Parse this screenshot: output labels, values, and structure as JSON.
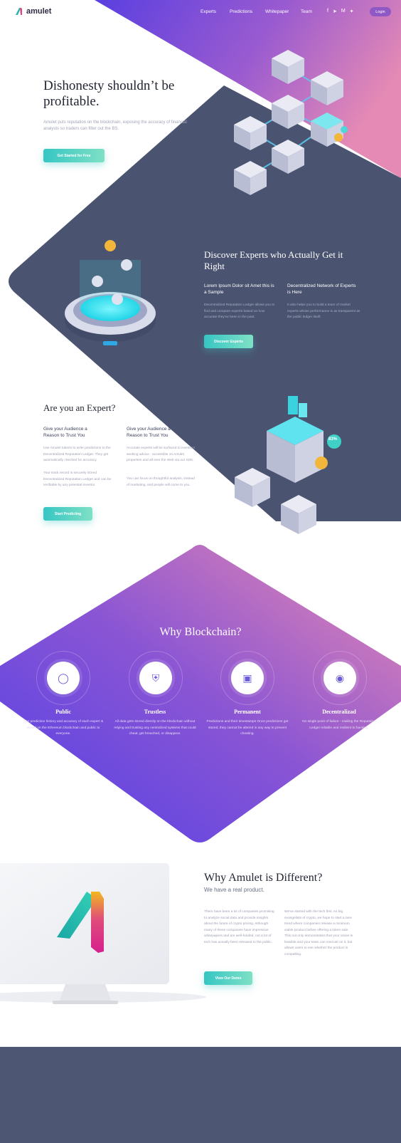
{
  "brand": {
    "name": "amulet"
  },
  "nav": {
    "items": [
      "Experts",
      "Predictions",
      "Whitepaper",
      "Team"
    ],
    "socials": [
      "facebook-icon",
      "telegram-icon",
      "medium-icon",
      "twitter-icon"
    ],
    "login": "Login"
  },
  "hero": {
    "title": "Dishonesty shouldn’t be profitable.",
    "lead": "Amulet puts reputation on the blockchain, exposing the accuracy of financial analysts so traders can filter out the BS.",
    "cta": "Get Started for Free"
  },
  "discover": {
    "title": "Discover Experts who Actually Get it Right",
    "col1_title": "Lorem Ipsum Dolor sit Amet this is a Sample",
    "col1_text": "Decentralized Reputation Ledger allows you to find and compare experts based on how accurate they've been in the past.",
    "col2_title": "Decentralized Network of Experts is Here",
    "col2_text": "It also helps you to build a team of market experts whose performance is as transparent as the public ledger itself.",
    "cta": "Discover Experts"
  },
  "expert": {
    "title": "Are you an Expert?",
    "col1_title": "Give your Audience a Reason to Trust You",
    "col1_text1": "Use Amulet tokens to write predictions to the Decentralized Reputation Ledger. They get automatically checked for accuracy.",
    "col1_text2": "Your track record is securely stored Decentralized Reputation Ledger and can be verifiable by any potential investor.",
    "col2_title": "Give your Audience a Reason to Trust You",
    "col2_text1": "Accurate experts will be surfaced to investors seeking advice - accessible on Amulet properties and all over the Web via our SDK.",
    "col2_text2": "You can focus on thoughtful analysis, instead of marketing, and people will come to you.",
    "cta": "Start Predicting",
    "badge": "83%"
  },
  "why": {
    "title": "Why Blockchain?",
    "features": [
      {
        "title": "Public",
        "text": "The prediction history and accuracy of each expert is stored on the Ethereum blockchain and public to everyone.",
        "icon": "globe-icon"
      },
      {
        "title": "Trustless",
        "text": "All data gets stored directly on the blockchain without relying and trusting any centralized systems that could cheat, get breached, or disappear.",
        "icon": "shield-icon"
      },
      {
        "title": "Permanent",
        "text": "Predictions and their timestamps Once predictions get stored, they cannot be altered in any way to prevent cheating.",
        "icon": "lock-icon"
      },
      {
        "title": "Decentralizad",
        "text": "No single point of failure - making the Reputation Ledger reliable and resilient to hacking.",
        "icon": "power-icon"
      }
    ]
  },
  "different": {
    "title": "Why Amulet is Different?",
    "subtitle": "We have a real product.",
    "col1_text": "There have been a lot of companies promising to analyze social data and provide insights about the future of crypto pricing. Although many of these companies have impressive whitepapers and are well-funded, not a lot of tech has actually been released to the public.",
    "col2_text": "We've started with the tech first. As big evangelists of crypto, we hope to start a new trend where companies release a minimum viable product before offering a token sale. This not only demonstrates that your vision is feasible and your team can execute on it, but allows users to see whether the product is compelling.",
    "cta": "View Our Demo"
  },
  "colors": {
    "accent_teal": "#36c6c4",
    "purple": "#6a3fe0",
    "pink": "#e586b0",
    "navy": "#4b5570"
  }
}
